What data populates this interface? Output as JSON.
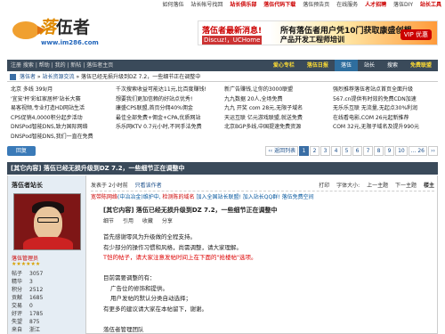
{
  "topbar": {
    "links": [
      {
        "label": "如何落伍",
        "hl": false
      },
      {
        "label": "站长帐号找回",
        "hl": false
      },
      {
        "label": "站长俱乐部",
        "hl": true
      },
      {
        "label": "落伍代码下载",
        "hl": true
      },
      {
        "label": "落伍预告页",
        "hl": false
      },
      {
        "label": "在线服务",
        "hl": false
      },
      {
        "label": "人才招聘",
        "hl": true
      },
      {
        "label": "落伍DIY",
        "hl": false
      },
      {
        "label": "站长工具",
        "hl": true
      }
    ]
  },
  "logo": {
    "lo": "落",
    "name": "伍者",
    "url": "www.im286.com"
  },
  "banner": {
    "line1": "落伍者最新消息!",
    "line2": "所有落伍者用户凭10门获取康盛创想",
    "tag": "Discuz!，UCHome",
    "line4": "产品开发工程师培训",
    "vip": "VIP 优惠"
  },
  "nav": {
    "links": "注册 搜索 | 帮助 | 我的 | 新帖 | 落伍者主页",
    "tabs": [
      {
        "label": "爱心专栏",
        "style": "yel"
      },
      {
        "label": "落伍日报",
        "style": "yel"
      },
      {
        "label": "落伍",
        "style": "active"
      },
      {
        "label": "站长",
        "style": ""
      },
      {
        "label": "搜索",
        "style": ""
      },
      {
        "label": "免费联盟",
        "style": "yel"
      }
    ]
  },
  "breadcrumb": {
    "site": "落伍者",
    "sep1": " » ",
    "forum": "站长资源交流",
    "sep2": " » ",
    "current": "落伍已经无损升级到DZ 7.2，一些细节正在调整中"
  },
  "ads": {
    "col1": [
      "北京 多线 399/月",
      "'宜安'杯'彩虹家居杯'站长大赛",
      "易客视频,专业打造HD网站生活",
      "CPS促销4,0000积分起步活动",
      "DNSPod智能DNS,致力国际网络",
      "DNSPod智能DNS,我们一直在免费"
    ],
    "col2": [
      "千次搜索收益可能达11元,比百度赚钱!",
      "想要我们更加信赖的好站点优秀!",
      "康盛CPS联盟,首页分佣40%佣金",
      "最佳全部免费+佣金+CPA,优质网站",
      "乐乐网KTV 0.7元小时,不同手法免费"
    ],
    "col3": [
      "新广告赚钱,让你的3000联盟",
      "九九数据 20人,全场免费",
      "九九 开奖 com 28元,无限子域名",
      "天运互联 亿元游戏联盟,就送免费",
      "北京BGP多线,中国提速免费资源"
    ],
    "col4": [
      "强烈推荐落伍者站点首页全面升级",
      "567.cn提供有时效的免费CDN加速",
      "无乐乐互联 无流量,无起点30%利润",
      "在线看电影,COM 26元起新推荐",
      "COM 32元,无限子域名及提升990元"
    ]
  },
  "reply_button": "回复",
  "pager": [
    "‹‹ 返回列表",
    "1",
    "2",
    "3",
    "4",
    "5",
    "6",
    "7",
    "8",
    "9",
    "10",
    "... 26",
    "››"
  ],
  "thread_title": "[其它内容] 落伍已经无损升级到DZ 7.2，一些细节正在调整中",
  "post": {
    "user": {
      "name": "落伍者站长",
      "role": "落伍管理员",
      "stars": "★★★★★★",
      "stats": [
        [
          "帖子",
          "3057"
        ],
        [
          "精华",
          "3"
        ],
        [
          "积分",
          "2512"
        ],
        [
          "贡献",
          "1685"
        ],
        [
          "交易",
          "0"
        ],
        [
          "好评",
          "1785"
        ],
        [
          "失望",
          "875"
        ],
        [
          "来自",
          "浙江"
        ]
      ]
    },
    "meta": {
      "time": "发表于 2小时前",
      "author_only": "只看该作者",
      "print": "打印",
      "font": "字体大小:",
      "prev": "上一主题",
      "next": "下一主题",
      "floor": "楼主"
    },
    "notice": {
      "a": "宽带陈网络",
      "b": "(中冶冶金)维护中,",
      "c": "检测陈的域名",
      "d": "加入全国站长联盟!",
      "e": "加入站长QQ群!",
      "f": "落伍免费空间"
    },
    "title": "[其它内容] 落伍已经无损升级到DZ 7.2，一些细节正在调整中",
    "actions": [
      "细节",
      "引用",
      "收藏",
      "分享"
    ],
    "body": [
      {
        "text": "首先感谢零风为升级做的全程支持。",
        "cls": ""
      },
      {
        "text": "有少部分的操作习惯和风格，尚需调整，请大家理解。",
        "cls": ""
      },
      {
        "text": "T恺的帖子，请大家注意发帖时间上在下面的\"抢楼帖\"选项。",
        "cls": "red"
      },
      {
        "text": "",
        "cls": "gap"
      },
      {
        "text": "目前需要调整的有：",
        "cls": ""
      },
      {
        "text": "广告位的修饰和提供。",
        "cls": "indent"
      },
      {
        "text": "用户发帖的默认分类自动选择；",
        "cls": "indent"
      },
      {
        "text": "有更多的建议请大家在本帖留下，谢谢。",
        "cls": ""
      },
      {
        "text": "",
        "cls": "gap"
      },
      {
        "text": "落伍者管理团队",
        "cls": ""
      }
    ]
  }
}
